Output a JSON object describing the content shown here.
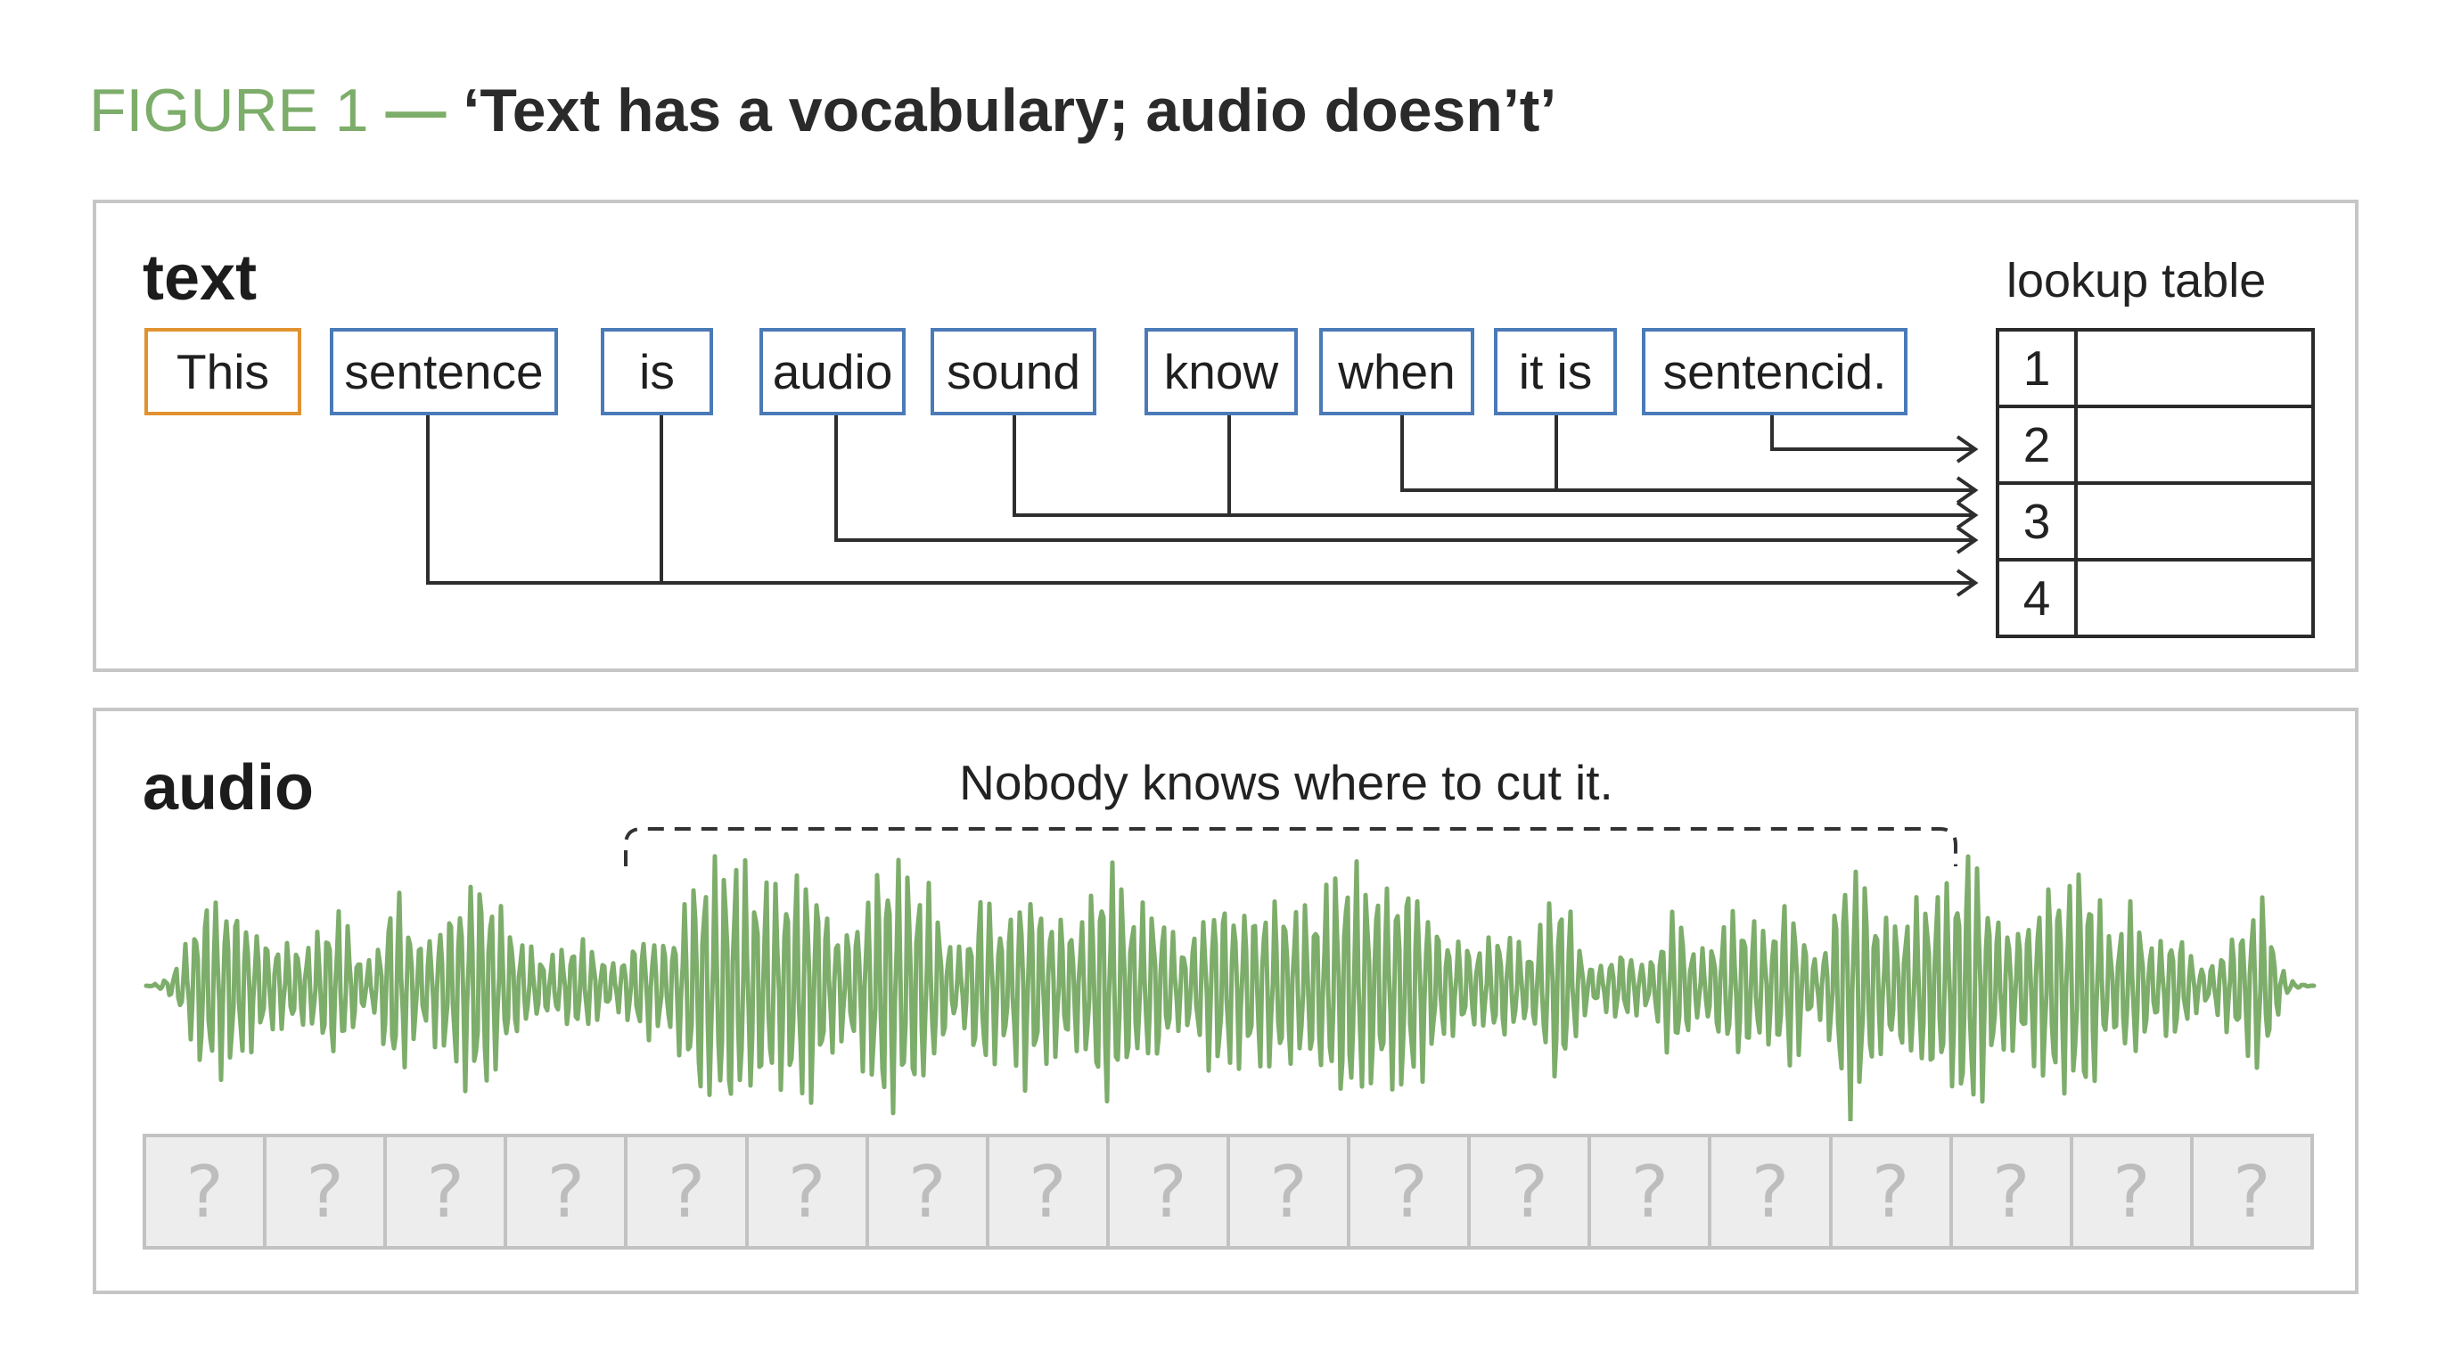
{
  "figure": {
    "label": "FIGURE 1",
    "separator": "—",
    "title": "‘Text has a vocabulary; audio doesn’t’"
  },
  "text_panel": {
    "label": "text",
    "tokens": [
      "This",
      "sentence",
      "is",
      "audio",
      "sound",
      "know",
      "when",
      "it is",
      "sentencid."
    ],
    "lookup_title": "lookup table",
    "lookup_rows": [
      "1",
      "2",
      "3",
      "4"
    ]
  },
  "audio_panel": {
    "label": "audio",
    "caption": "Nobody knows where to cut it.",
    "slots": [
      "?",
      "?",
      "?",
      "?",
      "?",
      "?",
      "?",
      "?",
      "?",
      "?",
      "?",
      "?",
      "?",
      "?",
      "?",
      "?",
      "?",
      "?"
    ]
  },
  "colors": {
    "accent_green": "#7dad6a",
    "token_border": "#4a7ab8",
    "highlight_token_border": "#e0922f",
    "wave": "#7dad6a"
  }
}
